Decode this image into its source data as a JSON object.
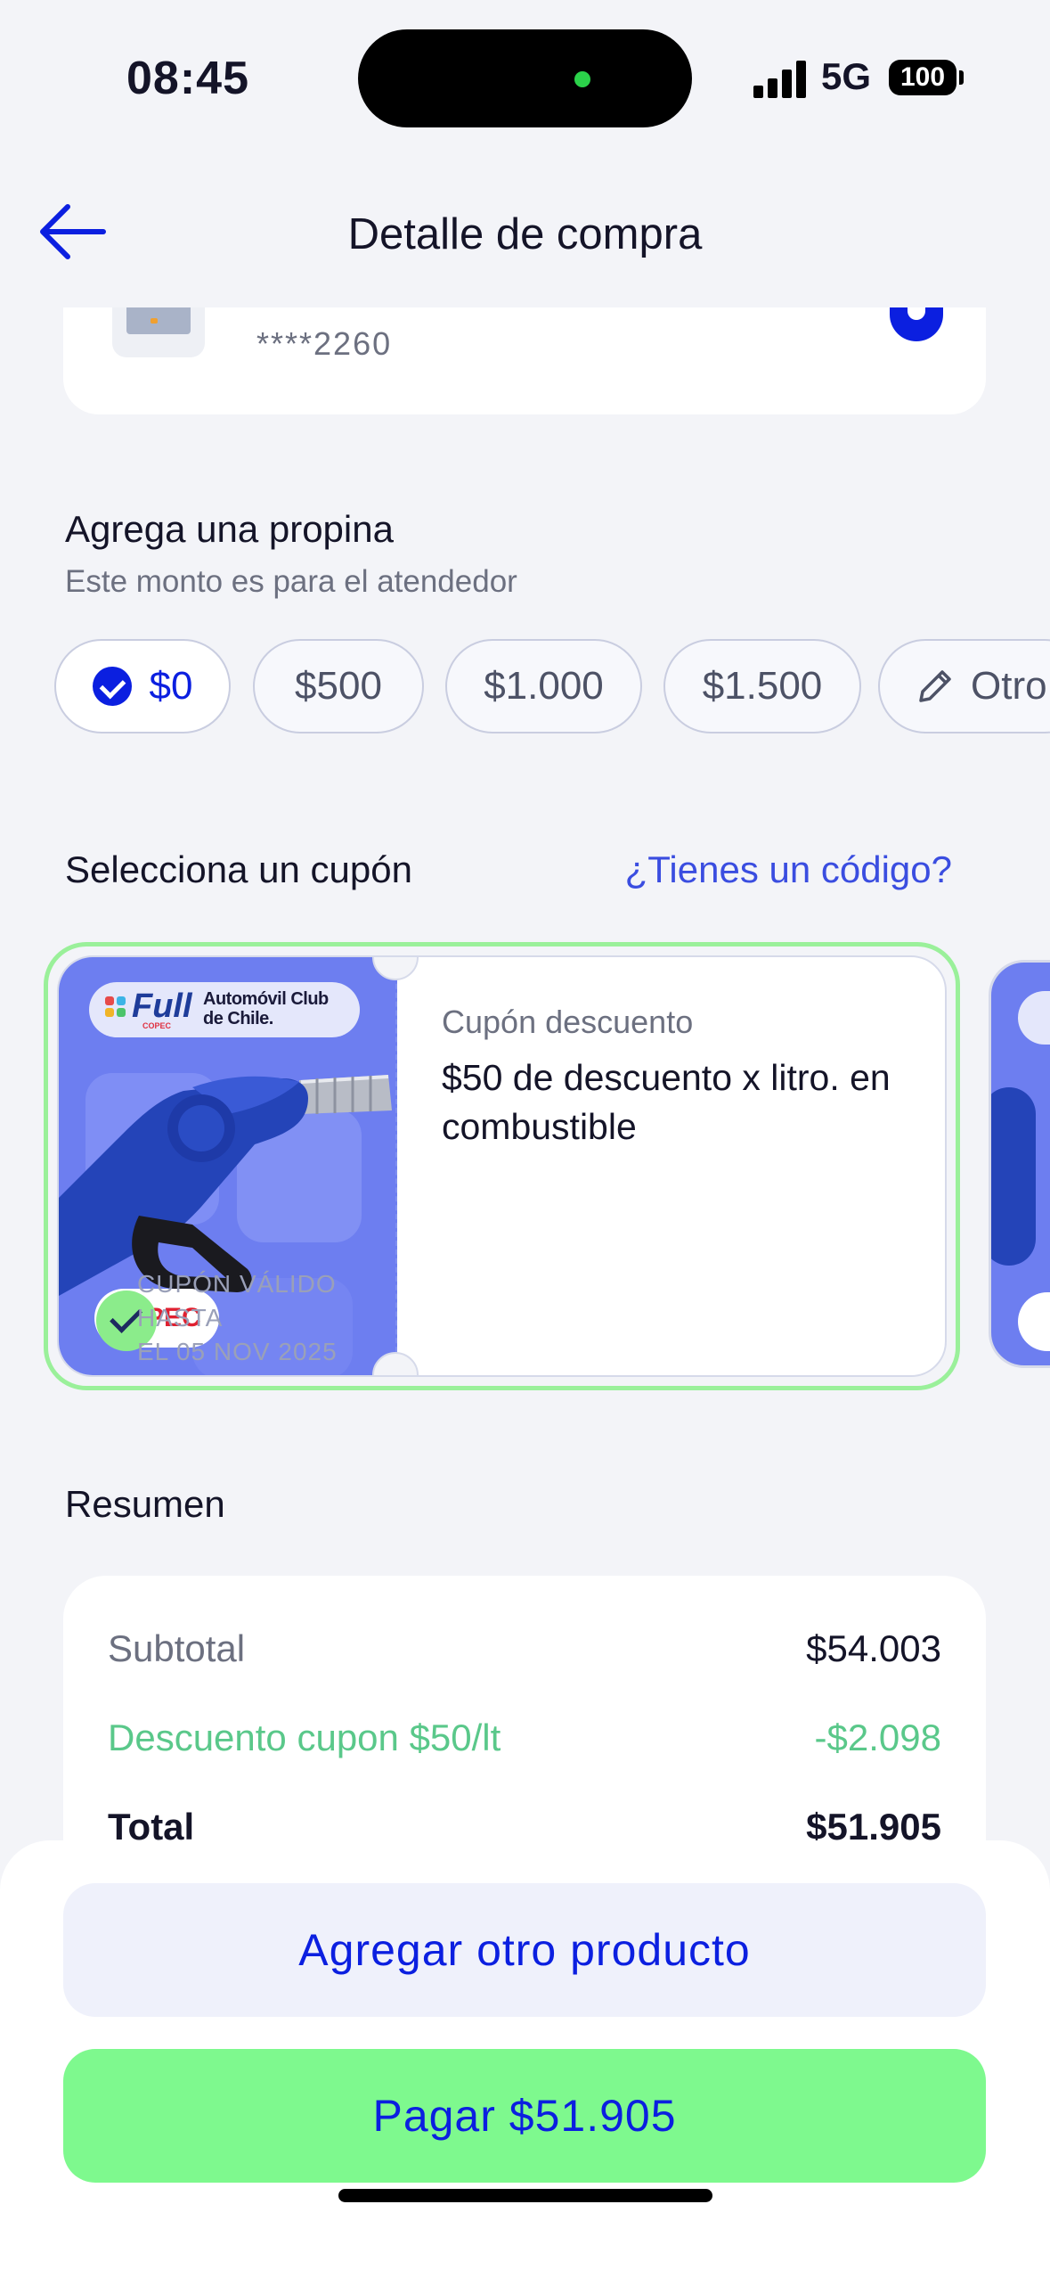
{
  "status_bar": {
    "time": "08:45",
    "network": "5G",
    "battery": "100"
  },
  "header": {
    "title": "Detalle de compra",
    "back_icon": "arrow-left-icon"
  },
  "payment_card": {
    "masked_number": "****2260",
    "selected": true
  },
  "tip": {
    "title": "Agrega una propina",
    "subtitle": "Este monto es para el atendedor",
    "options": [
      {
        "label": "$0",
        "selected": true
      },
      {
        "label": "$500",
        "selected": false
      },
      {
        "label": "$1.000",
        "selected": false
      },
      {
        "label": "$1.500",
        "selected": false
      },
      {
        "label": "Otro",
        "selected": false
      }
    ]
  },
  "coupons": {
    "title": "Selecciona un cupón",
    "code_link": "¿Tienes un código?",
    "items": [
      {
        "brand_badge": "Full",
        "brand_sub": "COPEC",
        "partner": "Automóvil Club de Chile.",
        "pill_text": "PEC",
        "label": "Cupón descuento",
        "description": "$50 de descuento x litro. en combustible",
        "valid_line1": "CUPÓN VÁLIDO HASTA",
        "valid_line2": "EL 05 NOV 2025",
        "selected": true
      }
    ]
  },
  "summary": {
    "title": "Resumen",
    "rows": [
      {
        "label": "Subtotal",
        "value": "$54.003"
      },
      {
        "label": "Descuento cupon $50/lt",
        "value": "-$2.098"
      },
      {
        "label": "Total",
        "value": "$51.905"
      }
    ]
  },
  "actions": {
    "add_product": "Agregar otro producto",
    "pay": "Pagar $51.905"
  },
  "colors": {
    "accent": "#0b1fe0",
    "pay_button": "#7ef98e",
    "discount": "#5ac88a",
    "coupon_bg": "#6d7ef0"
  }
}
